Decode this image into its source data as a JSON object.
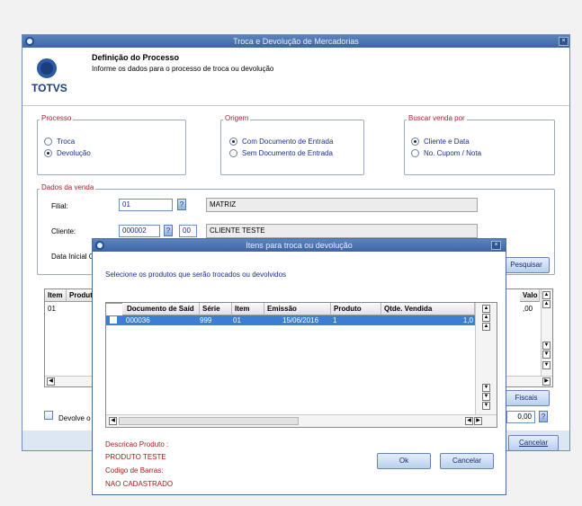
{
  "main": {
    "title": "Troca e Devolução de Mercadorias",
    "close": "×",
    "header_title": "Definição do Processo",
    "header_sub": "Informe os dados para o processo de troca ou devolução",
    "logo": "TOTVS",
    "processo": {
      "legend": "Processo",
      "opt1": "Troca",
      "opt2": "Devolução"
    },
    "origem": {
      "legend": "Origem",
      "opt1": "Com Documento de Entrada",
      "opt2": "Sem Documento de Entrada"
    },
    "buscar": {
      "legend": "Buscar venda por",
      "opt1": "Cliente e Data",
      "opt2": "No. Cupom / Nota"
    },
    "dados": {
      "legend": "Dados da venda",
      "filial_label": "Filial:",
      "filial_value": "01",
      "filial_desc": "MATRIZ",
      "cliente_label": "Cliente:",
      "cliente_value": "000002",
      "loja_value": "00",
      "cliente_desc": "CLIENTE TESTE",
      "data_label": "Data Inicial C",
      "q": "?"
    },
    "pesquisar": "Pesquisar",
    "grid": {
      "col_item": "Item",
      "col_produto": "Produt",
      "col_valor": "Valo",
      "row_item": "01",
      "row_valor": ",00"
    },
    "fiscais": "Fiscais",
    "devolve": "Devolve o",
    "total": "0,00",
    "cancelar": "Cancelar"
  },
  "dialog": {
    "title": "Itens para troca ou devolução",
    "close": "×",
    "instruction": "Selecione os produtos que serão trocados ou devolvidos",
    "columns": [
      "Documento de Saíd",
      "Série",
      "Item",
      "Emissão",
      "Produto",
      "Qtde. Vendida"
    ],
    "row": [
      "000036",
      "999",
      "01",
      "15/06/2016",
      "1",
      "1,0"
    ],
    "desc_label": "Descricao Produto :",
    "desc_value": "PRODUTO TESTE",
    "barcode_label": "Codigo de Barras:",
    "barcode_value": "NAO CADASTRADO",
    "ok": "Ok",
    "cancelar": "Cancelar"
  }
}
